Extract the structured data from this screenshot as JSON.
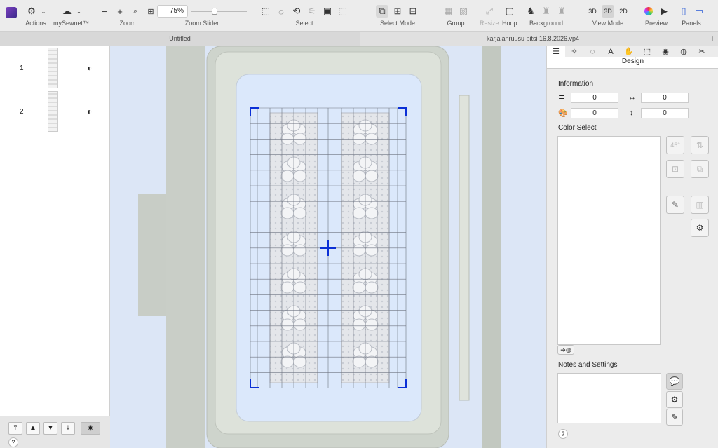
{
  "toolbar": {
    "actions_label": "Actions",
    "mysewnet_label": "mySewnet™",
    "zoom_label": "Zoom",
    "zoom_value": "75%",
    "zoom_slider_label": "Zoom Slider",
    "select_label": "Select",
    "select_mode_label": "Select Mode",
    "group_label": "Group",
    "resize_label": "Resize",
    "hoop_label": "Hoop",
    "background_label": "Background",
    "view_mode_label": "View Mode",
    "view_3d_a": "3D",
    "view_3d_b": "3D",
    "view_2d": "2D",
    "preview_label": "Preview",
    "panels_label": "Panels",
    "zoom_out_glyph": "−",
    "zoom_in_glyph": "+"
  },
  "tabs": {
    "tab1": "Untitled",
    "tab2": "karjalanruusu pitsi  16.8.2026.vp4",
    "add": "+"
  },
  "layers": [
    {
      "number": "1"
    },
    {
      "number": "2"
    }
  ],
  "right": {
    "title": "Design",
    "information": "Information",
    "stitches": "0",
    "width": "0",
    "colors": "0",
    "height": "0",
    "color_select": "Color Select",
    "notes": "Notes and Settings",
    "rotate45": "45°",
    "help": "?"
  },
  "left_help": "?",
  "accent": "#0a2fd6"
}
